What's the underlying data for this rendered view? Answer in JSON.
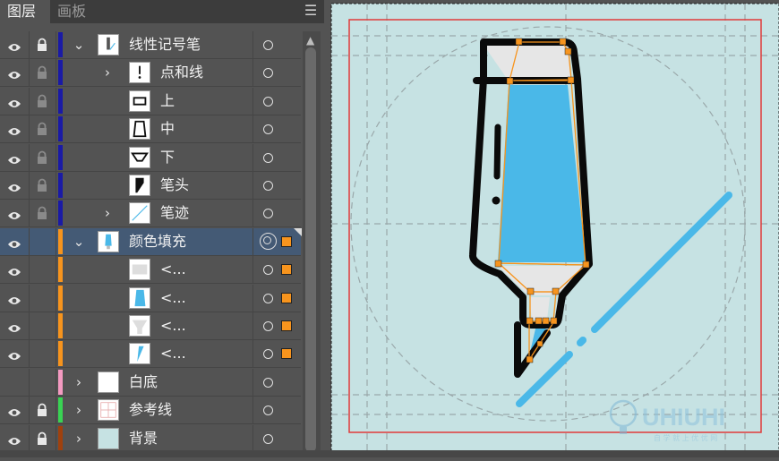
{
  "tabs": [
    {
      "label": "图层",
      "active": true
    },
    {
      "label": "画板",
      "active": false
    }
  ],
  "layers": [
    {
      "name": "线性记号笔",
      "visible": true,
      "locked": true,
      "color": "#1a1aa6",
      "expand": "open",
      "level": 0,
      "target": "circle",
      "selected": false
    },
    {
      "name": "点和线",
      "visible": true,
      "locked": true,
      "color": "#1a1aa6",
      "expand": "closed",
      "level": 1,
      "target": "circle",
      "selected": false
    },
    {
      "name": "上",
      "visible": true,
      "locked": true,
      "color": "#1a1aa6",
      "expand": "none",
      "level": 1,
      "target": "circle",
      "selected": false
    },
    {
      "name": "中",
      "visible": true,
      "locked": true,
      "color": "#1a1aa6",
      "expand": "none",
      "level": 1,
      "target": "circle",
      "selected": false
    },
    {
      "name": "下",
      "visible": true,
      "locked": true,
      "color": "#1a1aa6",
      "expand": "none",
      "level": 1,
      "target": "circle",
      "selected": false
    },
    {
      "name": "笔头",
      "visible": true,
      "locked": true,
      "color": "#1a1aa6",
      "expand": "none",
      "level": 1,
      "target": "circle",
      "selected": false
    },
    {
      "name": "笔迹",
      "visible": true,
      "locked": true,
      "color": "#1a1aa6",
      "expand": "closed",
      "level": 1,
      "target": "circle",
      "selected": false
    },
    {
      "name": "颜色填充",
      "visible": true,
      "locked": false,
      "color": "#f7941d",
      "expand": "open",
      "level": 0,
      "target": "double",
      "selected": true
    },
    {
      "name": "<...",
      "visible": true,
      "locked": false,
      "color": "#f7941d",
      "expand": "none",
      "level": 1,
      "target": "circle",
      "selected": true
    },
    {
      "name": "<...",
      "visible": true,
      "locked": false,
      "color": "#f7941d",
      "expand": "none",
      "level": 1,
      "target": "circle",
      "selected": true
    },
    {
      "name": "<...",
      "visible": true,
      "locked": false,
      "color": "#f7941d",
      "expand": "none",
      "level": 1,
      "target": "circle",
      "selected": true
    },
    {
      "name": "<...",
      "visible": true,
      "locked": false,
      "color": "#f7941d",
      "expand": "none",
      "level": 1,
      "target": "circle",
      "selected": true
    },
    {
      "name": "白底",
      "visible": false,
      "locked": false,
      "color": "#f49ac1",
      "expand": "closed",
      "level": 0,
      "target": "circle",
      "selected": false
    },
    {
      "name": "参考线",
      "visible": true,
      "locked": true,
      "color": "#39d353",
      "expand": "closed",
      "level": 0,
      "target": "circle",
      "selected": false
    },
    {
      "name": "背景",
      "visible": true,
      "locked": true,
      "color": "#a0410d",
      "expand": "closed",
      "level": 0,
      "target": "circle",
      "selected": false
    }
  ],
  "artboard": {
    "bg": "#c6e2e3",
    "stroke": "#111111",
    "fill_blue": "#4ab8e8",
    "fill_gray": "#e6e6e6",
    "guide": "#e03a3a",
    "selection": "#f7941d"
  },
  "watermark": {
    "logo": "UHIUHI",
    "tagline": "自 学 就 上 优 优 网"
  }
}
